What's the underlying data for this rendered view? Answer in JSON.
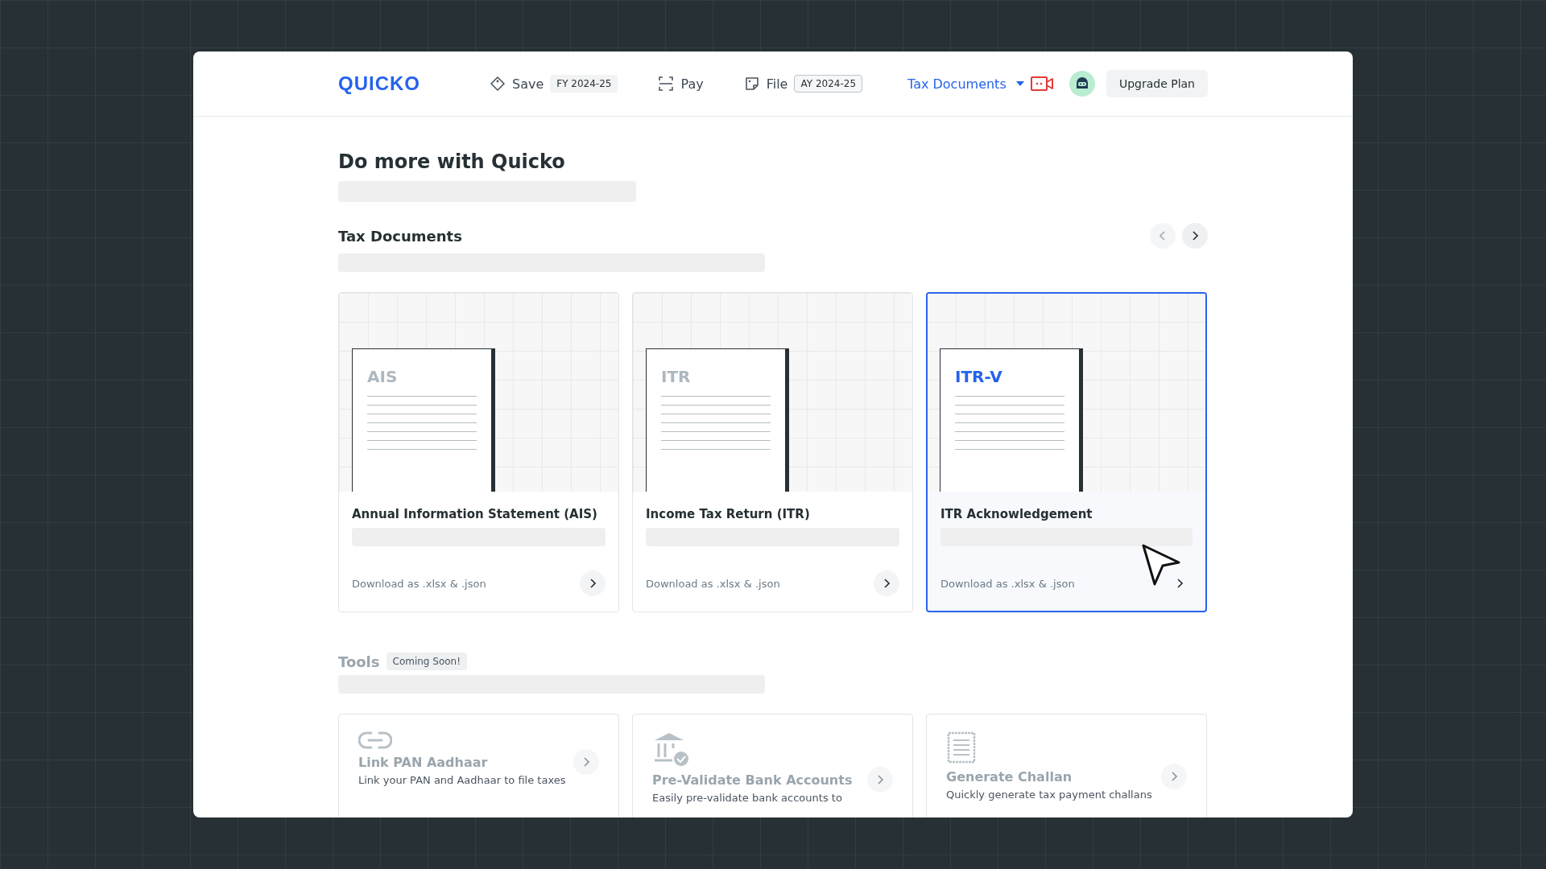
{
  "header": {
    "logo": "QUICKO",
    "nav": [
      {
        "kind": "tag",
        "label": "Save",
        "badge": "FY 2024-25",
        "badge_selected": false
      },
      {
        "kind": "scan",
        "label": "Pay"
      },
      {
        "kind": "file",
        "label": "File",
        "badge": "AY 2024-25",
        "badge_selected": true
      }
    ],
    "dropdown": {
      "label": "Tax Documents",
      "selected": true
    },
    "upgrade_button": "Upgrade Plan"
  },
  "heading": "Do more with Quicko",
  "tax_documents": {
    "title": "Tax Documents",
    "carousel_buttons": [
      {
        "kind": "prev",
        "disabled": true
      },
      {
        "kind": "next",
        "disabled": false
      }
    ],
    "cards": [
      {
        "doc_label": "AIS",
        "title": "Annual Information Statement (AIS)",
        "link": "Download as .xlsx & .json",
        "selected": false
      },
      {
        "doc_label": "ITR",
        "title": "Income Tax Return (ITR)",
        "link": "Download as .xlsx & .json",
        "selected": false
      },
      {
        "doc_label": "ITR-V",
        "title": "ITR Acknowledgement",
        "link": "Download as .xlsx & .json",
        "selected": true
      }
    ]
  },
  "tools": {
    "title": "Tools",
    "badge": "Coming Soon!",
    "cards": [
      {
        "kind": "link",
        "title": "Link PAN Aadhaar",
        "description": "Link your PAN and Aadhaar to file taxes",
        "disabled": true
      },
      {
        "kind": "bank",
        "title": "Pre-Validate Bank Accounts",
        "description": "Easily pre-validate bank accounts to",
        "disabled": true
      },
      {
        "kind": "receipt",
        "title": "Generate Challan",
        "description": "Quickly generate tax payment challans",
        "disabled": true
      }
    ]
  }
}
